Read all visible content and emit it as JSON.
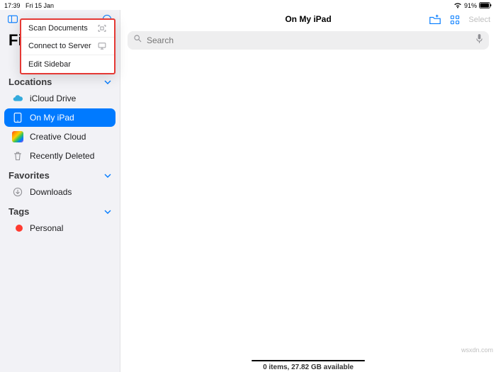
{
  "status": {
    "time": "17:39",
    "date": "Fri 15 Jan",
    "battery": "91%"
  },
  "app_title": "Fil",
  "popover": {
    "scan": "Scan Documents",
    "connect": "Connect to Server",
    "edit": "Edit Sidebar"
  },
  "sections": {
    "locations": {
      "header": "Locations",
      "items": {
        "icloud": "iCloud Drive",
        "ipad": "On My iPad",
        "cc": "Creative Cloud",
        "trash": "Recently Deleted"
      }
    },
    "favorites": {
      "header": "Favorites",
      "items": {
        "downloads": "Downloads"
      }
    },
    "tags": {
      "header": "Tags",
      "items": {
        "personal": "Personal"
      }
    }
  },
  "main": {
    "title": "On My iPad",
    "search_placeholder": "Search",
    "select_label": "Select",
    "status_line": "0 items, 27.82 GB available"
  },
  "watermark": "wsxdn.com"
}
